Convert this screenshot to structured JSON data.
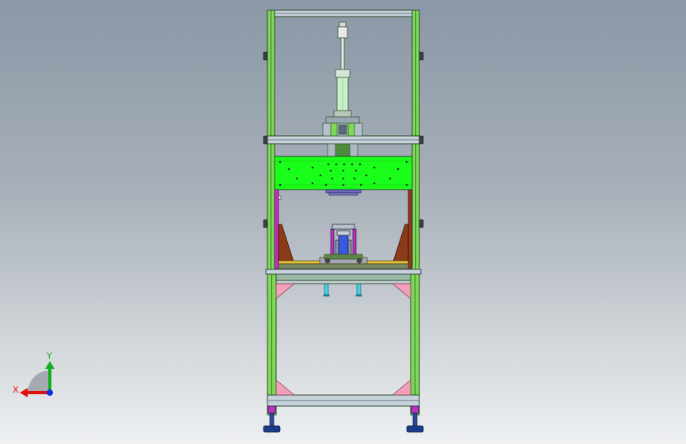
{
  "triad": {
    "x_label": "X",
    "y_label": "Y",
    "x_color": "#e01010",
    "y_color": "#10b020",
    "z_color": "#1030e0"
  },
  "colors": {
    "frame_profile": "#7ed957",
    "frame_edge": "#2c4a23",
    "crossbar": "#c7d3dc",
    "mount_plate": "#1aff1a",
    "gusset_pink": "#f2a0b8",
    "bracket_brown": "#8b3a1a",
    "cylinder_body": "#c8f0c8",
    "cylinder_rod": "#e8e8e8",
    "fixture_blue": "#3a5be0",
    "fixture_magenta": "#c030c0",
    "rail_yellow": "#e0c040",
    "foot_blue": "#2a4a9a",
    "pin_cyan": "#40d0e0"
  }
}
